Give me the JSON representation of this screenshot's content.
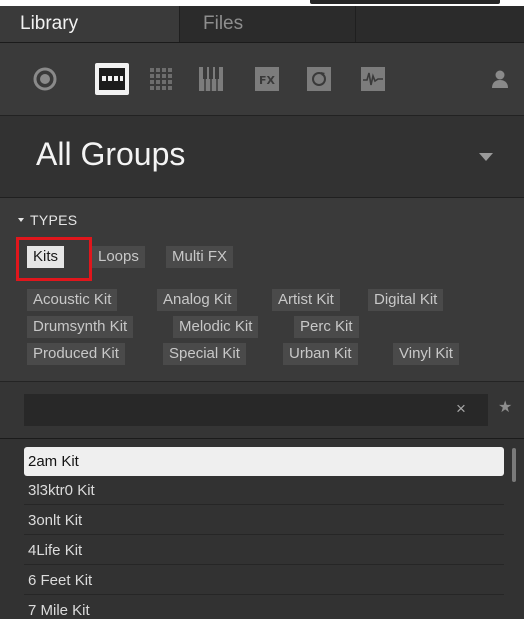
{
  "tabs": {
    "library": "Library",
    "files": "Files"
  },
  "icons": [
    "record-icon",
    "kit-icon",
    "grid-icon",
    "piano-icon",
    "fx-icon",
    "loop-icon",
    "waveform-icon",
    "user-icon"
  ],
  "header": {
    "title": "All Groups"
  },
  "types": {
    "label": "TYPES",
    "primary": [
      {
        "label": "Kits",
        "selected": true
      },
      {
        "label": "Loops",
        "selected": false
      },
      {
        "label": "Multi FX",
        "selected": false
      }
    ],
    "sub": [
      "Acoustic Kit",
      "Analog Kit",
      "Artist Kit",
      "Digital Kit",
      "Drumsynth Kit",
      "Melodic Kit",
      "Perc Kit",
      "Produced Kit",
      "Special Kit",
      "Urban Kit",
      "Vinyl Kit"
    ]
  },
  "search": {
    "value": "",
    "clear": "×",
    "favorite": "★"
  },
  "results": [
    "2am Kit",
    "3l3ktr0 Kit",
    "3onlt Kit",
    "4Life Kit",
    "6 Feet Kit",
    "7 Mile Kit"
  ],
  "colors": {
    "highlight": "#e0161c",
    "selected": "#e6e6e6",
    "panel": "#3a3a3a"
  }
}
